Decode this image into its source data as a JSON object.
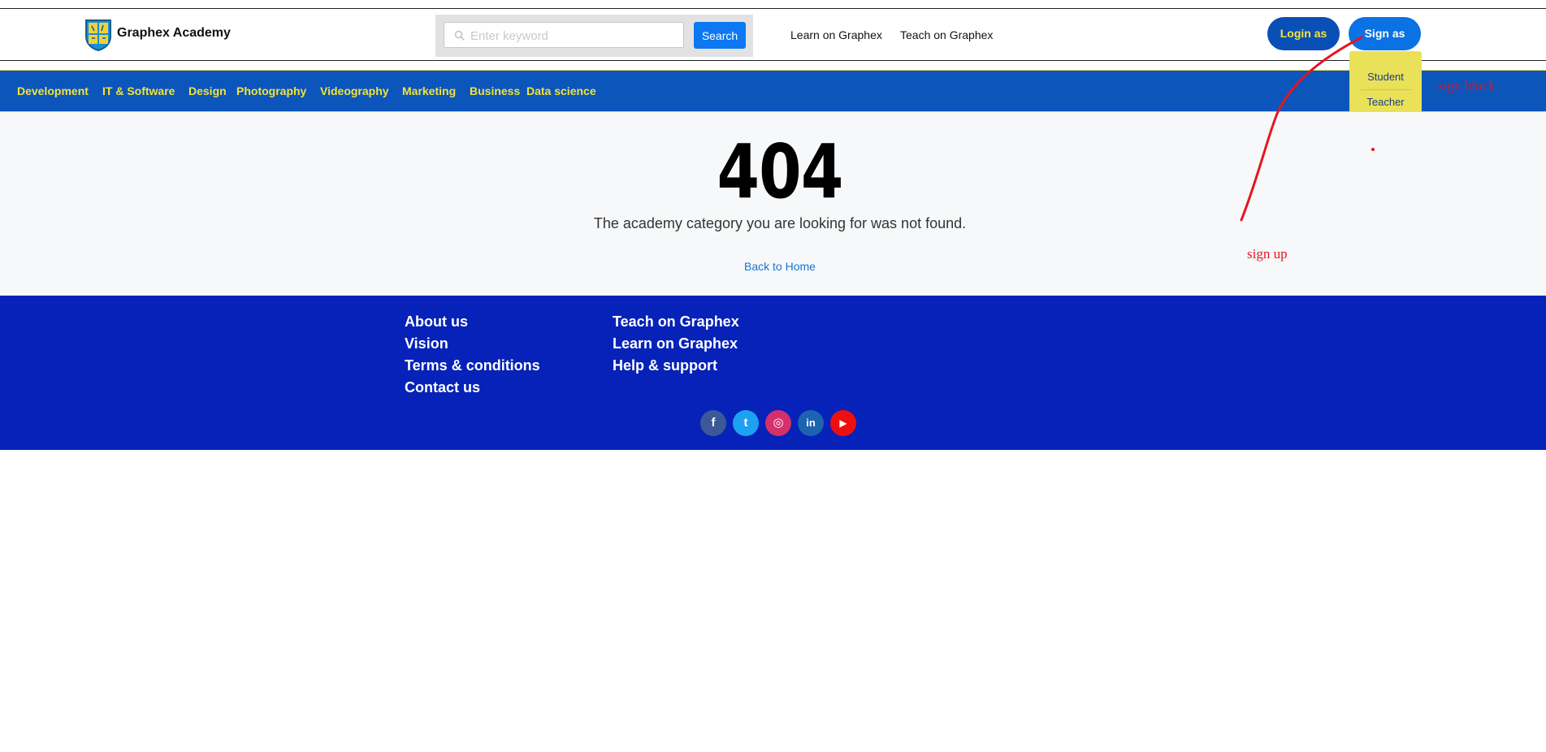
{
  "header": {
    "brand": "Graphex Academy",
    "search": {
      "placeholder": "Enter keyword",
      "button": "Search"
    },
    "links": [
      "Learn on Graphex",
      "Teach on Graphex"
    ],
    "login_button": "Login as",
    "signup_button": "Sign as"
  },
  "signup_menu": {
    "items": [
      "Student",
      "Teacher"
    ]
  },
  "categories": [
    "Development",
    "IT & Software",
    "Design",
    "Photography",
    "Videography",
    "Marketing",
    "Business",
    "Data science"
  ],
  "error": {
    "code": "404",
    "message": "The academy category you are looking for was not found.",
    "back_link": "Back to Home"
  },
  "footer": {
    "col1": [
      "About us",
      "Vision",
      "Terms & conditions",
      "Contact us"
    ],
    "col2": [
      "Teach on Graphex",
      "Learn on Graphex",
      "Help & support"
    ],
    "social": [
      {
        "icon": "facebook-icon",
        "glyph": "f",
        "color": "#3b5998"
      },
      {
        "icon": "twitter-icon",
        "glyph": "t",
        "color": "#1da1f2"
      },
      {
        "icon": "instagram-icon",
        "glyph": "◎",
        "color": "#d6306a"
      },
      {
        "icon": "linkedin-icon",
        "glyph": "in",
        "color": "#1d64b0"
      },
      {
        "icon": "youtube-icon",
        "glyph": "▶",
        "color": "#ee0f0f"
      }
    ]
  },
  "annotations": {
    "sign_block": "sign block",
    "sign_up": "sign up"
  },
  "colors": {
    "nav_bg": "#0b55bb",
    "nav_text": "#f1e33b",
    "footer_bg": "#0622b8",
    "dropdown_bg": "#e9e157",
    "annotation": "#e8141e"
  }
}
